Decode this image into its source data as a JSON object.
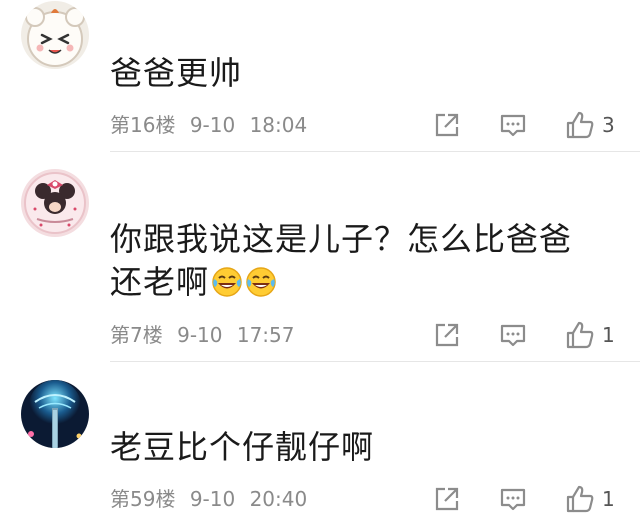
{
  "comments": [
    {
      "text_lines": [
        "爸爸更帅"
      ],
      "emojis": [],
      "floor": "第16楼",
      "date": "9-10",
      "time": "18:04",
      "likes": "3",
      "avatar": "cartoon-face-avatar"
    },
    {
      "text_lines": [
        "你跟我说这是儿子？怎么比爸爸",
        "还老啊"
      ],
      "emojis": [
        "laughing-crying-emoji",
        "laughing-crying-emoji"
      ],
      "floor": "第7楼",
      "date": "9-10",
      "time": "17:57",
      "likes": "1",
      "avatar": "minnie-mouse-avatar"
    },
    {
      "text_lines": [
        "老豆比个仔靓仔啊"
      ],
      "emojis": [],
      "floor": "第59楼",
      "date": "9-10",
      "time": "20:40",
      "likes": "1",
      "avatar": "night-tower-avatar"
    }
  ],
  "icons": {
    "share": "share-icon",
    "reply": "reply-icon",
    "like": "thumbs-up-icon"
  },
  "colors": {
    "meta_text": "#8a8a8a",
    "icon_stroke": "#8c8c8c",
    "divider": "#e6e6e6",
    "emoji_face": "#ffcc33"
  }
}
